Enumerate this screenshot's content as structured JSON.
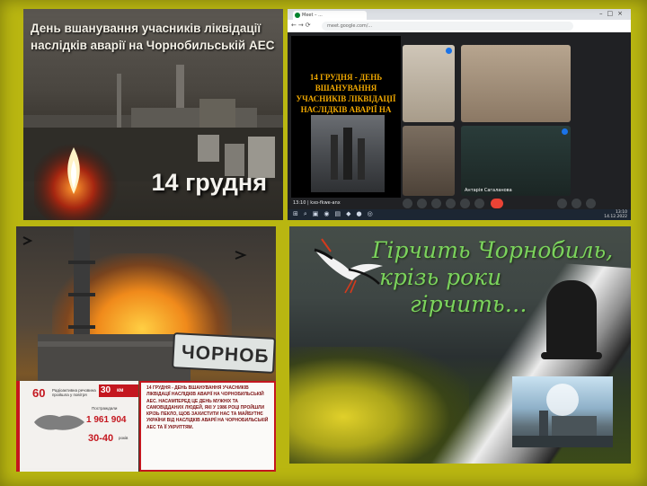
{
  "colors": {
    "background": "#b9b611",
    "poem_green": "#7bd35c",
    "info_red": "#c4171f",
    "meet_end_call": "#ea4335"
  },
  "panel_commemoration": {
    "title": "День вшанування учасників ліквідації наслідків аварії на Чорнобильській АЕС",
    "date": "14 грудня",
    "icons": [
      "candle-icon",
      "reactor-icon"
    ]
  },
  "panel_video_call": {
    "browser_tab_title": "Meet – ...",
    "address_bar": "meet.google.com/...",
    "presentation_title": "14 ГРУДНЯ - ДЕНЬ ВШАНУВАННЯ УЧАСНИКІВ ЛІКВІДАЦІЇ НАСЛІДКІВ АВАРІЇ НА ЧАЕС",
    "participant_name": "Антарія Сагаланова",
    "meeting_code": "13:10 | kxo-fkwe-anx",
    "clock_time": "13:10",
    "clock_date": "14.12.2022"
  },
  "panel_disaster": {
    "road_sign": "ЧОРНОБ",
    "stats": {
      "s1_num": "60",
      "s1_text": "Радіоактивна речовина пройшла у повітря",
      "s2_num": "30",
      "s2_text": "км",
      "s3_label": "Постраждали",
      "s3_num": "1 961 904",
      "s4_num": "30-40",
      "s4_text": "років"
    },
    "info_text": "14 грудня - День вшанування учасників ліквідації наслідків аварії на Чорнобильській АЕС. Насамперед це день мужніх та самовідданих людей, які у 1986 році пройшли крізь пекло, щоб захистити нас та майбутнє України від наслідків аварії на Чорнобильській АЕС та її укриттям."
  },
  "panel_poem": {
    "line1": "Гірчить Чорнобиль,",
    "line2": "крізь роки",
    "line3": "гірчить…",
    "icons": [
      "stork-icon",
      "bell-icon"
    ]
  }
}
